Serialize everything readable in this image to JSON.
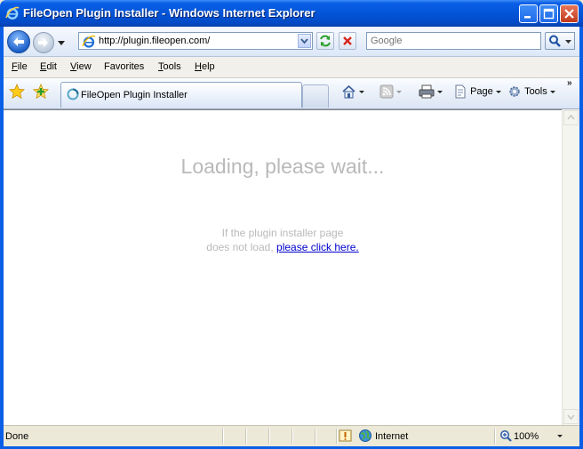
{
  "window": {
    "title": "FileOpen Plugin Installer - Windows Internet Explorer"
  },
  "address_bar": {
    "url": "http://plugin.fileopen.com/"
  },
  "search": {
    "placeholder": "Google"
  },
  "menu": {
    "items": [
      {
        "key": "F",
        "rest": "ile"
      },
      {
        "key": "E",
        "rest": "dit"
      },
      {
        "key": "V",
        "rest": "iew"
      },
      {
        "key": "",
        "first": "F",
        "rest": "avorites"
      },
      {
        "key": "T",
        "rest": "ools"
      },
      {
        "key": "H",
        "rest": "elp"
      }
    ]
  },
  "tabs": {
    "active_title": "FileOpen Plugin Installer"
  },
  "commands": {
    "page_label": "Page",
    "tools_label": "Tools",
    "chevron": "»"
  },
  "content": {
    "heading": "Loading, please wait...",
    "message_line1": "If the plugin installer page",
    "message_line2": "does not load,",
    "link_text": "please click here."
  },
  "status": {
    "text": "Done",
    "zone": "Internet",
    "zoom": "100%"
  },
  "icons": {
    "ie_logo": "ie-logo-icon",
    "back": "back-arrow-icon",
    "forward": "forward-arrow-icon",
    "refresh": "refresh-icon",
    "stop": "stop-icon",
    "search": "magnifier-icon",
    "favorites": "star-icon",
    "add_favorite": "add-favorite-icon",
    "home": "home-icon",
    "feeds": "rss-feed-icon",
    "print": "printer-icon",
    "page": "page-icon",
    "tools": "gear-icon",
    "internet_zone": "globe-icon",
    "zoom": "zoom-magnifier-icon"
  },
  "colors": {
    "titlebar": "#0355d8",
    "link": "#0000cc",
    "loading_text": "#b9b9b9"
  }
}
